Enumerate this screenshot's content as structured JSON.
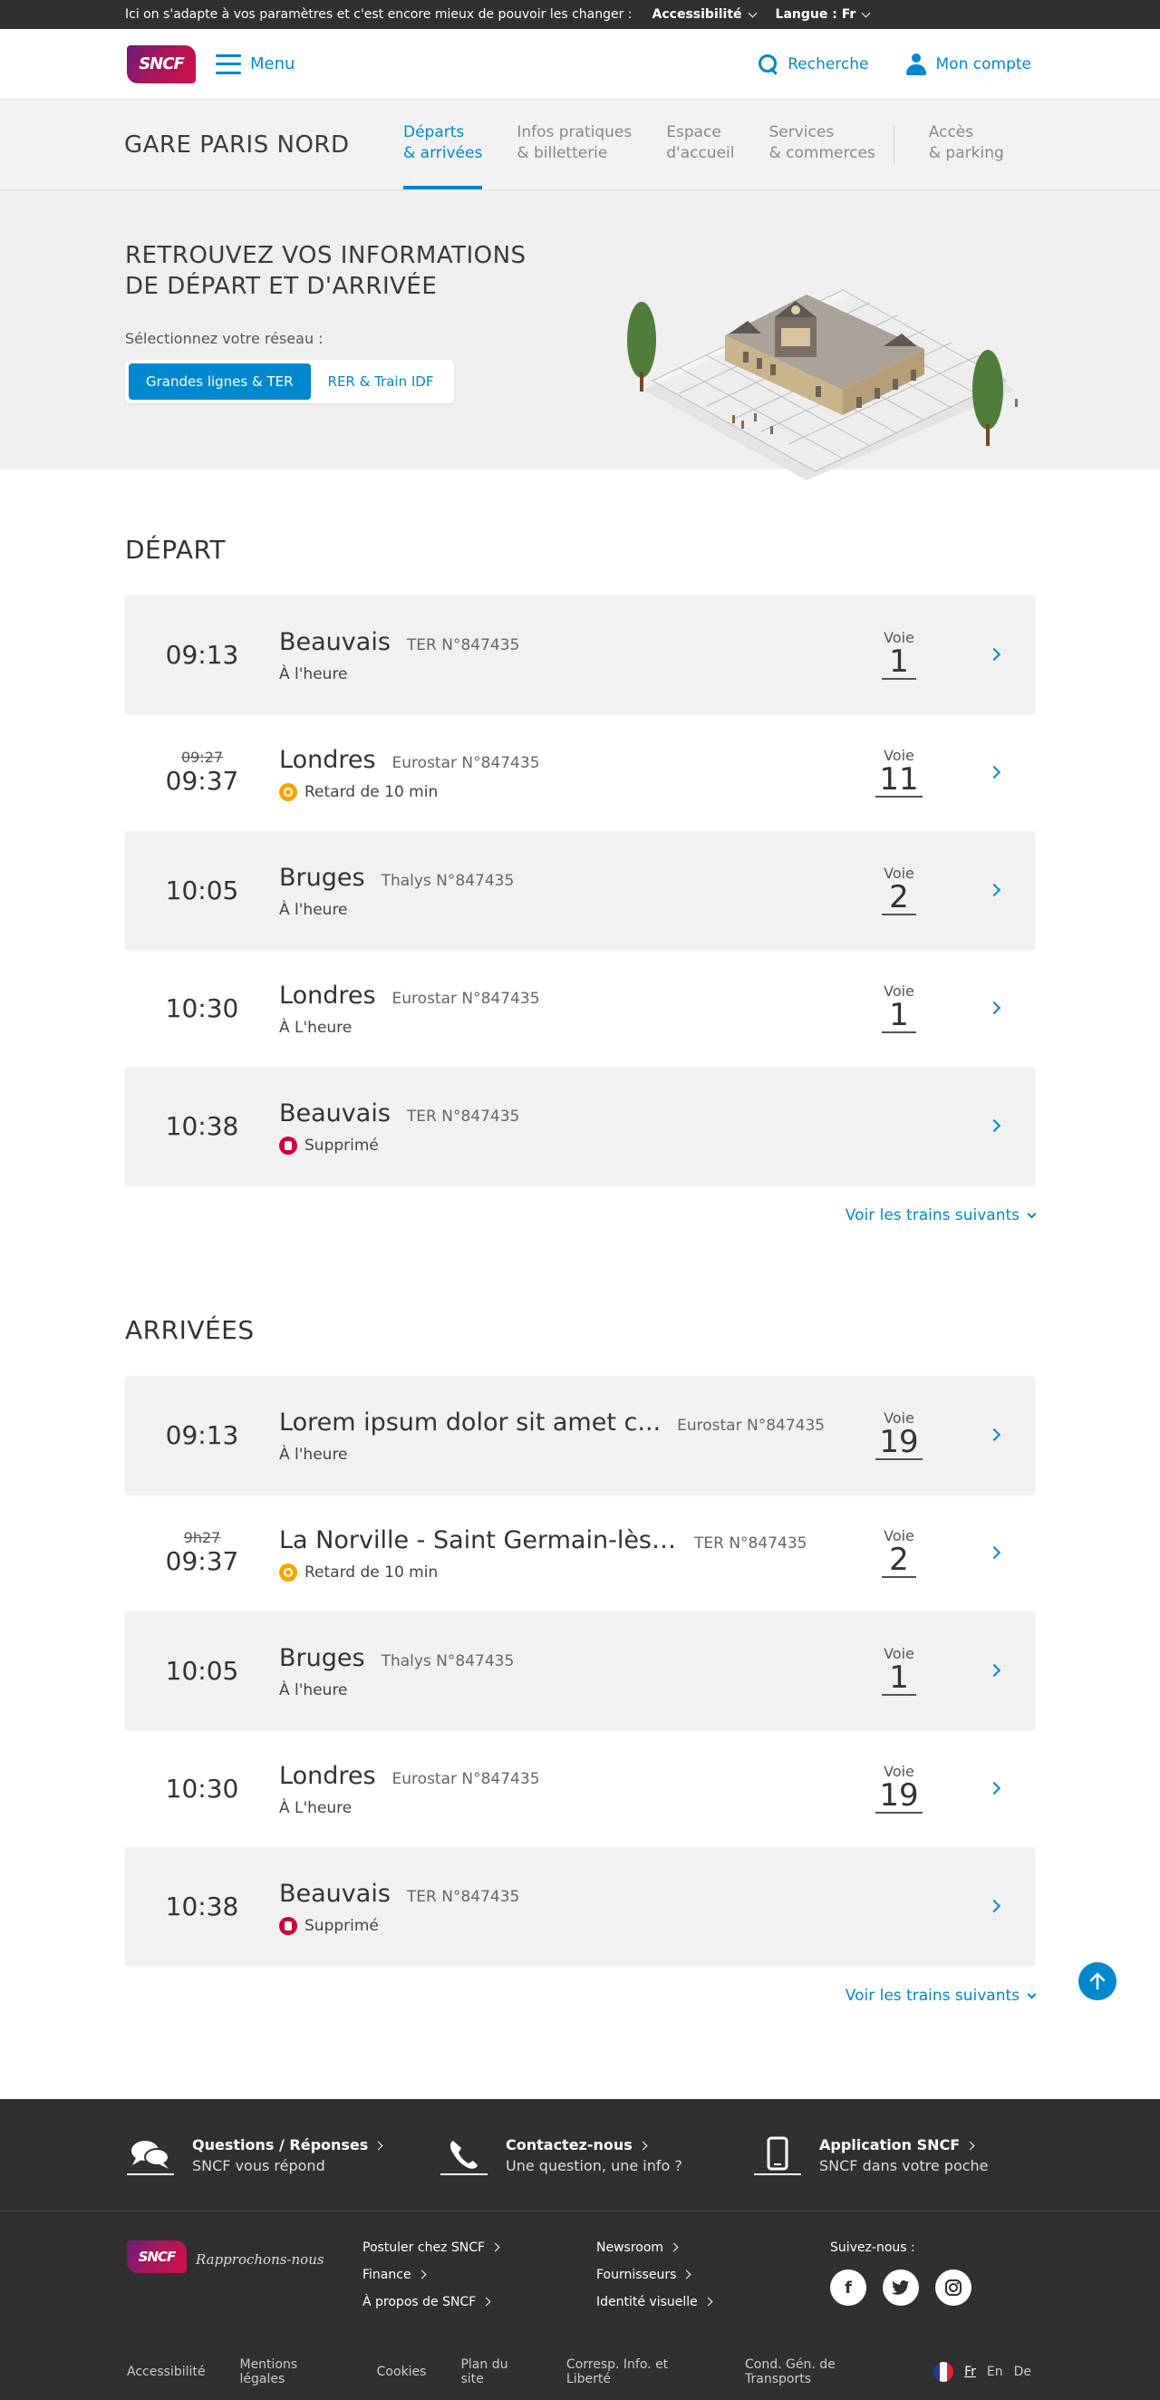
{
  "topbar": {
    "message": "Ici on s'adapte à vos paramètres et c'est encore mieux de pouvoir les changer :",
    "accessibility": "Accessibilité",
    "language": "Langue : Fr"
  },
  "header": {
    "logo": "SNCF",
    "menu": "Menu",
    "search": "Recherche",
    "account": "Mon compte"
  },
  "station": {
    "name": "GARE PARIS NORD",
    "tabs": [
      {
        "label": "Départs\n& arrivées",
        "active": true
      },
      {
        "label": "Infos pratiques\n& billetterie",
        "active": false
      },
      {
        "label": "Espace\nd'accueil",
        "active": false
      },
      {
        "label": "Services\n& commerces",
        "active": false
      },
      {
        "label": "Accès\n& parking",
        "active": false
      }
    ]
  },
  "hero": {
    "title": "RETROUVEZ VOS INFORMATIONS\nDE DÉPART ET D'ARRIVÉE",
    "select_label": "Sélectionnez votre réseau :",
    "networks": [
      "Grandes lignes & TER",
      "RER & Train IDF"
    ]
  },
  "departures": {
    "title": "DÉPART",
    "rows": [
      {
        "time_old": "",
        "time": "09:13",
        "destination": "Beauvais",
        "train": "TER N°847435",
        "status": "À l'heure",
        "status_type": "ok",
        "voie_label": "Voie",
        "voie": "1"
      },
      {
        "time_old": "09:27",
        "time": "09:37",
        "destination": "Londres",
        "train": "Eurostar N°847435",
        "status": "Retard de 10 min",
        "status_type": "delay",
        "voie_label": "Voie",
        "voie": "11"
      },
      {
        "time_old": "",
        "time": "10:05",
        "destination": "Bruges",
        "train": "Thalys N°847435",
        "status": "À l'heure",
        "status_type": "ok",
        "voie_label": "Voie",
        "voie": "2"
      },
      {
        "time_old": "",
        "time": "10:30",
        "destination": "Londres",
        "train": "Eurostar N°847435",
        "status": "À L'heure",
        "status_type": "ok",
        "voie_label": "Voie",
        "voie": "1"
      },
      {
        "time_old": "",
        "time": "10:38",
        "destination": "Beauvais",
        "train": "TER N°847435",
        "status": "Supprimé",
        "status_type": "cancel",
        "voie_label": "",
        "voie": ""
      }
    ],
    "more": "Voir les trains suivants"
  },
  "arrivals": {
    "title": "ARRIVÉES",
    "rows": [
      {
        "time_old": "",
        "time": "09:13",
        "destination": "Lorem ipsum dolor sit amet c...",
        "train": "Eurostar N°847435",
        "status": "À l'heure",
        "status_type": "ok",
        "voie_label": "Voie",
        "voie": "19"
      },
      {
        "time_old": "9h27",
        "time": "09:37",
        "destination": "La Norville - Saint Germain-lès-A...",
        "train": "TER N°847435",
        "status": "Retard de 10 min",
        "status_type": "delay",
        "voie_label": "Voie",
        "voie": "2"
      },
      {
        "time_old": "",
        "time": "10:05",
        "destination": "Bruges",
        "train": "Thalys N°847435",
        "status": "À l'heure",
        "status_type": "ok",
        "voie_label": "Voie",
        "voie": "1"
      },
      {
        "time_old": "",
        "time": "10:30",
        "destination": "Londres",
        "train": "Eurostar N°847435",
        "status": "À L'heure",
        "status_type": "ok",
        "voie_label": "Voie",
        "voie": "19"
      },
      {
        "time_old": "",
        "time": "10:38",
        "destination": "Beauvais",
        "train": "TER N°847435",
        "status": "Supprimé",
        "status_type": "cancel",
        "voie_label": "",
        "voie": ""
      }
    ],
    "more": "Voir les trains suivants"
  },
  "footer": {
    "services": [
      {
        "icon": "chat-bubbles-icon",
        "title": "Questions / Réponses",
        "sub": "SNCF vous répond"
      },
      {
        "icon": "phone-icon",
        "title": "Contactez-nous",
        "sub": "Une question, une info ?"
      },
      {
        "icon": "smartphone-icon",
        "title": "Application SNCF",
        "sub": "SNCF dans votre poche"
      }
    ],
    "logo": "SNCF",
    "slogan": "Rapprochons-nous",
    "links_col1": [
      "Postuler chez SNCF",
      "Finance",
      "À propos de SNCF"
    ],
    "links_col2": [
      "Newsroom",
      "Fournisseurs",
      "Identité visuelle"
    ],
    "follow": "Suivez-nous :",
    "socials": [
      "f",
      "t",
      "ig"
    ],
    "bottom_links": [
      "Accessibilité",
      "Mentions légales",
      "Cookies",
      "Plan du site",
      "Corresp. Info. et Liberté",
      "Cond. Gén. de Transports"
    ],
    "languages": [
      "Fr",
      "En",
      "De"
    ]
  },
  "colors": {
    "accent": "#0088ce",
    "dark": "#303030",
    "delay": "#f5a700",
    "cancel": "#cd0037"
  }
}
